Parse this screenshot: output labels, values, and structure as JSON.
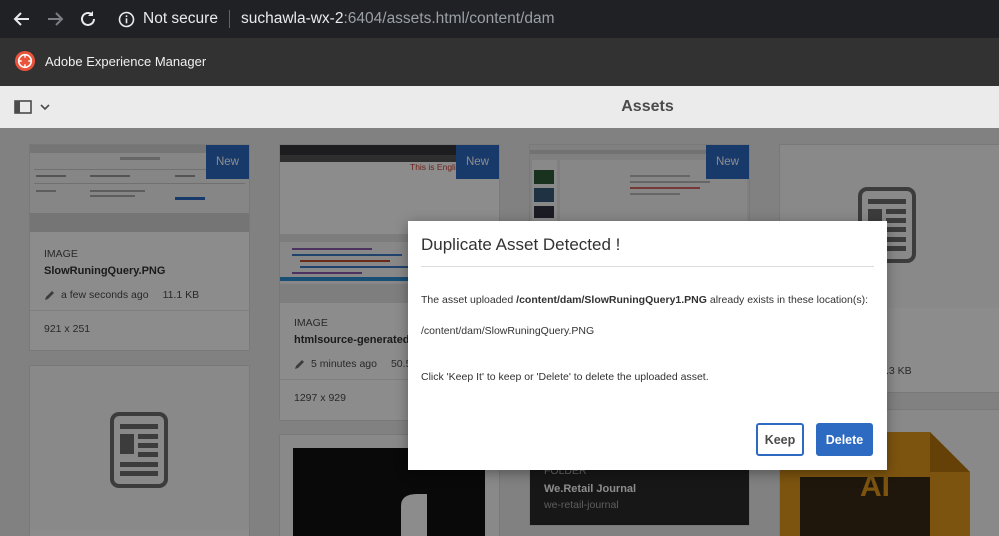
{
  "browser": {
    "security_label": "Not secure",
    "url_host": "suchawla-wx-2",
    "url_rest": ":6404/assets.html/content/dam"
  },
  "app": {
    "product_name": "Adobe Experience Manager"
  },
  "toolbar": {
    "page_title": "Assets"
  },
  "cards": [
    {
      "badge": "New",
      "type": "IMAGE",
      "name": "SlowRuningQuery.PNG",
      "modified": "a few seconds ago",
      "size": "11.1 KB",
      "dimensions": "921 x 251"
    },
    {
      "badge": "New",
      "type": "IMAGE",
      "name": "htmlsource-generated-",
      "modified": "5 minutes ago",
      "size": "50.5",
      "dimensions": "1297 x 929",
      "thumb_text": "This is English"
    },
    {
      "badge": "New"
    },
    {
      "size": ".3 KB"
    },
    {
      "type": "FOLDER",
      "name": "We.Retail Journal",
      "subtitle": "we-retail-journal"
    },
    {
      "partial_label": "AI"
    }
  ],
  "dialog": {
    "title": "Duplicate Asset Detected !",
    "msg_prefix": "The asset uploaded ",
    "msg_path": "/content/dam/SlowRuningQuery1.PNG",
    "msg_suffix": " already exists in these location(s):",
    "existing_location": "/content/dam/SlowRuningQuery.PNG",
    "instruction": "Click 'Keep It' to keep or 'Delete' to delete the uploaded asset.",
    "keep_label": "Keep",
    "delete_label": "Delete"
  },
  "colors": {
    "accent": "#2d6ac2",
    "shell_bar": "#323232",
    "browser_bar": "#202124",
    "file_ai_orange": "#e39a1d"
  },
  "icons": [
    "back-arrow-icon",
    "forward-arrow-icon",
    "reload-icon",
    "info-icon",
    "aem-logo-icon",
    "rail-toggle-icon",
    "chevron-down-icon",
    "pencil-icon",
    "document-placeholder-icon"
  ]
}
